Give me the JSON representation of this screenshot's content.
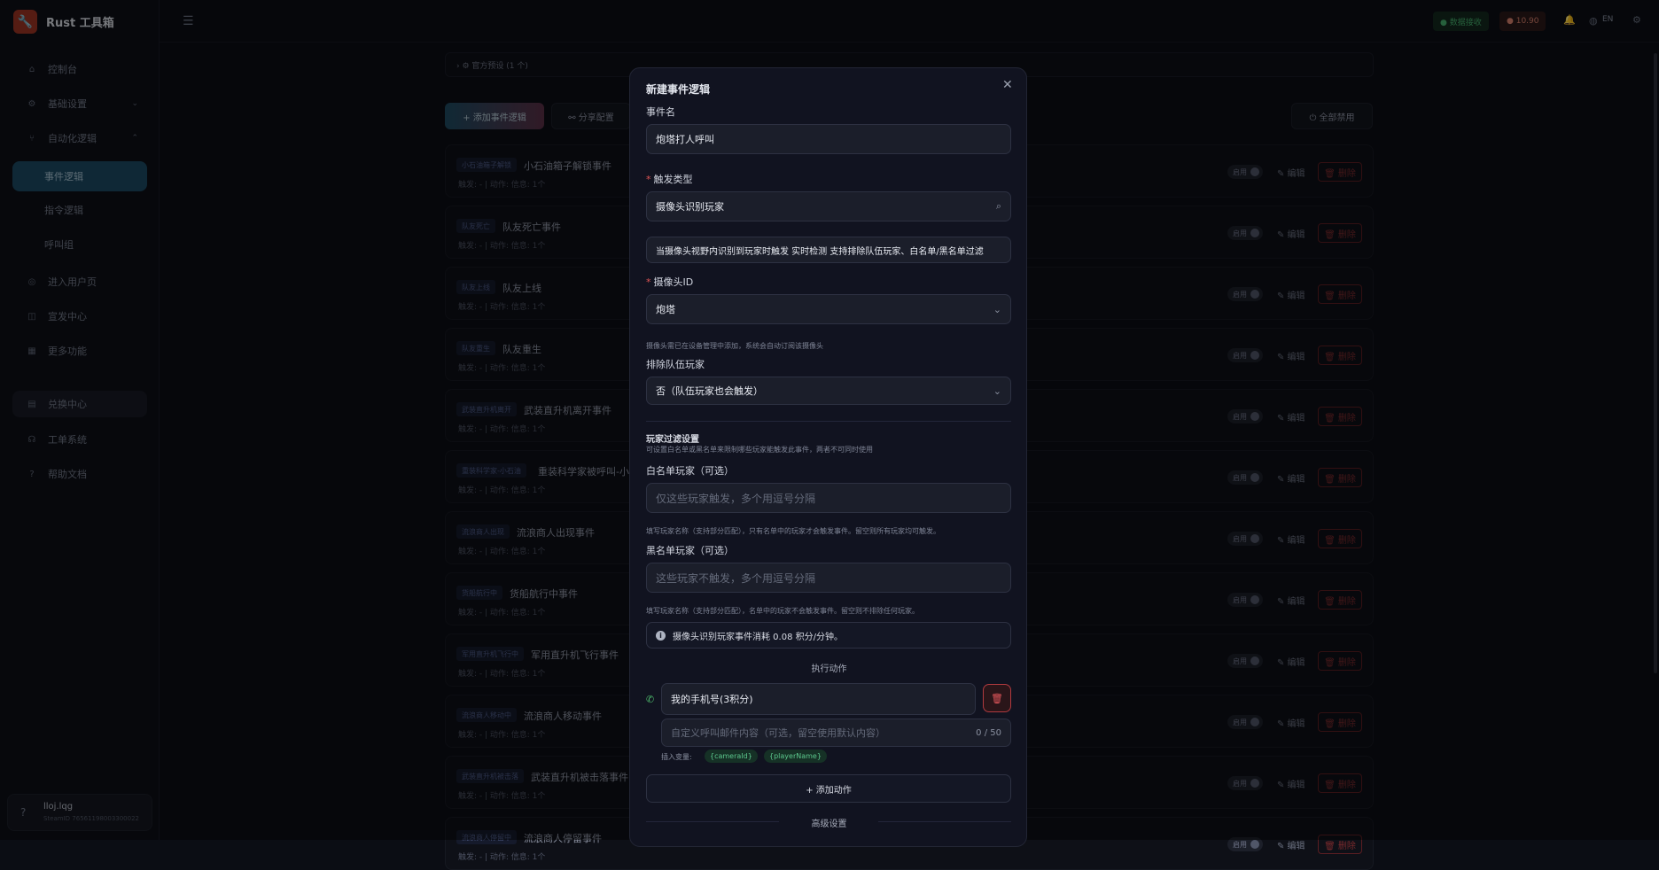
{
  "app": {
    "logo_glyph": "🔧",
    "title": "Rust 工具箱"
  },
  "sidebar": {
    "items": [
      {
        "label": "控制台",
        "icon": "⌂"
      },
      {
        "label": "基础设置",
        "icon": "⚙",
        "chev": "⌄"
      },
      {
        "label": "自动化逻辑",
        "icon": "⑂",
        "chev": "⌃"
      },
      {
        "label": "事件逻辑"
      },
      {
        "label": "指令逻辑"
      },
      {
        "label": "呼叫组"
      },
      {
        "label": "进入用户页",
        "icon": "◎"
      },
      {
        "label": "宣发中心",
        "icon": "◫"
      },
      {
        "label": "更多功能",
        "icon": "▦"
      },
      {
        "label": "兑换中心",
        "icon": "▤"
      },
      {
        "label": "工单系统",
        "icon": "☊"
      },
      {
        "label": "帮助文档",
        "icon": "?"
      }
    ],
    "user": {
      "icon": "?",
      "name": "lloj.lqg",
      "id": "SteamID 76561198003300022"
    }
  },
  "topbar": {
    "menu_icon": "☰",
    "status": "● 数据接收",
    "coins": "● 10.90",
    "bell": "🔔",
    "globe": "◍",
    "lang": "EN",
    "settings": "⚙"
  },
  "main": {
    "collapse_label": "›   ⚙  官方预设  (1 个)",
    "add_event_button": "+  添加事件逻辑",
    "share_button": "⚯  分享配置",
    "disable_all_button": "⏻  全部禁用",
    "rows": [
      {
        "tag": "小石油箱子解锁",
        "name": "小石油箱子解锁事件",
        "meta": "触发: -  |  动作: 信息: 1个"
      },
      {
        "tag": "队友死亡",
        "name": "队友死亡事件",
        "meta": "触发: -  |  动作: 信息: 1个"
      },
      {
        "tag": "队友上线",
        "name": "队友上线",
        "meta": "触发: -  |  动作: 信息: 1个"
      },
      {
        "tag": "队友重生",
        "name": "队友重生",
        "meta": "触发: -  |  动作: 信息: 1个"
      },
      {
        "tag": "武装直升机离开",
        "name": "武装直升机离开事件",
        "meta": "触发: -  |  动作: 信息: 1个"
      },
      {
        "tag": "重装科学家-小石油",
        "name": "重装科学家被呼叫-小石油",
        "meta": "触发: -  |  动作: 信息: 1个"
      },
      {
        "tag": "流浪商人出现",
        "name": "流浪商人出现事件",
        "meta": "触发: -  |  动作: 信息: 1个"
      },
      {
        "tag": "货船航行中",
        "name": "货船航行中事件",
        "meta": "触发: -  |  动作: 信息: 1个"
      },
      {
        "tag": "军用直升机飞行中",
        "name": "军用直升机飞行事件",
        "meta": "触发: -  |  动作: 信息: 1个"
      },
      {
        "tag": "流浪商人移动中",
        "name": "流浪商人移动事件",
        "meta": "触发: -  |  动作: 信息: 1个"
      },
      {
        "tag": "武装直升机被击落",
        "name": "武装直升机被击落事件",
        "meta": "触发: -  |  动作: 信息: 1个"
      },
      {
        "tag": "流浪商人停留中",
        "name": "流浪商人停留事件",
        "meta": "触发: -  |  动作: 信息: 1个"
      }
    ],
    "row_enable": "启用",
    "row_edit": "✎ 编辑",
    "row_delete": "🗑 删除"
  },
  "modal": {
    "title": "新建事件逻辑",
    "close": "✕",
    "event_name_label": "事件名",
    "event_name_value": "炮塔打人呼叫",
    "trigger_label": "触发类型",
    "trigger_value": "摄像头识别玩家",
    "trigger_search_icon": "⌕",
    "trigger_desc": "当摄像头视野内识别到玩家时触发 实时检测 支持排除队伍玩家、白名单/黑名单过滤",
    "camera_label": "摄像头ID",
    "camera_value": "炮塔",
    "camera_hint": "摄像头需已在设备管理中添加，系统会自动订阅该摄像头",
    "exclude_label": "排除队伍玩家",
    "exclude_value": "否（队伍玩家也会触发）",
    "chevron": "⌄",
    "filter_title": "玩家过滤设置",
    "filter_desc": "可设置白名单或黑名单来限制哪些玩家能触发此事件，两者不可同时使用",
    "whitelist_label": "白名单玩家（可选）",
    "whitelist_placeholder": "仅这些玩家触发，多个用逗号分隔",
    "whitelist_hint": "填写玩家名称（支持部分匹配），只有名单中的玩家才会触发事件。留空则所有玩家均可触发。",
    "blacklist_label": "黑名单玩家（可选）",
    "blacklist_placeholder": "这些玩家不触发，多个用逗号分隔",
    "blacklist_hint": "填写玩家名称（支持部分匹配），名单中的玩家不会触发事件。留空则不排除任何玩家。",
    "info_icon": "i",
    "info_text": "摄像头识别玩家事件消耗 0.08 积分/分钟。",
    "actions_title": "执行动作",
    "phone_icon": "✆",
    "action_value": "我的手机号(3积分)",
    "trash_icon": "🗑",
    "message_placeholder": "自定义呼叫邮件内容（可选，留空使用默认内容）",
    "message_count": "0 / 50",
    "vars_label": "插入变量:",
    "var_camera": "{cameraId}",
    "var_player": "{playerName}",
    "add_action": "+  添加动作",
    "advanced_title": "高级设置"
  }
}
